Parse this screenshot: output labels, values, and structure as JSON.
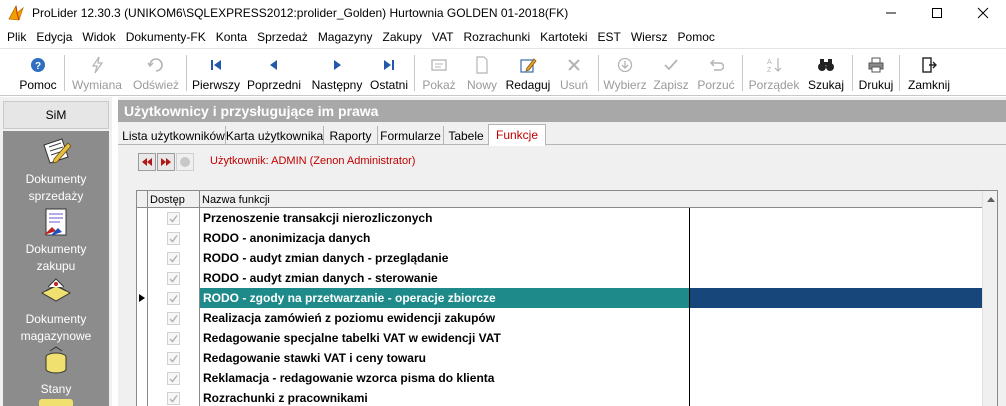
{
  "window": {
    "title": "ProLider 12.30.3  (UNIKOM6\\SQLEXPRESS2012:prolider_Golden) Hurtownia GOLDEN 01-2018(FK)"
  },
  "menu": [
    "Plik",
    "Edycja",
    "Widok",
    "Dokumenty-FK",
    "Konta",
    "Sprzedaż",
    "Magazyny",
    "Zakupy",
    "VAT",
    "Rozrachunki",
    "Kartoteki",
    "EST",
    "Wiersz",
    "Pomoc"
  ],
  "toolbar": {
    "pomoc": "Pomoc",
    "wymiana": "Wymiana",
    "odswiez": "Odśwież",
    "pierwszy": "Pierwszy",
    "poprzedni": "Poprzedni",
    "nastepny": "Następny",
    "ostatni": "Ostatni",
    "pokaz": "Pokaż",
    "nowy": "Nowy",
    "redaguj": "Redaguj",
    "usun": "Usuń",
    "wybierz": "Wybierz",
    "zapisz": "Zapisz",
    "porzuc": "Porzuć",
    "porzadek": "Porządek",
    "szukaj": "Szukaj",
    "drukuj": "Drukuj",
    "zamknij": "Zamknij"
  },
  "sidebar": {
    "header": "SiM",
    "items": [
      {
        "label": "Dokumenty sprzedaży",
        "icon": "sales-documents-icon"
      },
      {
        "label": "Dokumenty zakupu",
        "icon": "purchase-documents-icon"
      },
      {
        "label": "Dokumenty magazynowe",
        "icon": "warehouse-documents-icon"
      },
      {
        "label": "Stany",
        "icon": "stock-levels-icon"
      }
    ]
  },
  "main": {
    "title": "Użytkownicy i przysługujące im prawa",
    "tabs": [
      "Lista użytkowników",
      "Karta użytkownika",
      "Raporty",
      "Formularze",
      "Tabele",
      "Funkcje"
    ],
    "active_tab": "Funkcje",
    "user_label": "Użytkownik: ADMIN  (Zenon Administrator)"
  },
  "grid": {
    "columns": [
      "Dostęp",
      "Nazwa funkcji"
    ],
    "rows": [
      {
        "checked": true,
        "name": "Przenoszenie transakcji nierozliczonych"
      },
      {
        "checked": true,
        "name": "RODO - anonimizacja danych"
      },
      {
        "checked": true,
        "name": "RODO - audyt zmian danych - przeglądanie"
      },
      {
        "checked": true,
        "name": "RODO - audyt zmian danych - sterowanie"
      },
      {
        "checked": true,
        "name": "RODO - zgody na przetwarzanie - operacje zbiorcze",
        "selected": true
      },
      {
        "checked": true,
        "name": "Realizacja zamówień z poziomu ewidencji zakupów"
      },
      {
        "checked": true,
        "name": "Redagowanie specjalne tabelki VAT w ewidencji VAT"
      },
      {
        "checked": true,
        "name": "Redagowanie stawki VAT i ceny towaru"
      },
      {
        "checked": true,
        "name": "Reklamacja - redagowanie wzorca pisma do klienta"
      },
      {
        "checked": true,
        "name": "Rozrachunki z pracownikami"
      }
    ]
  },
  "colors": {
    "selected_cell": "#1f8a8a",
    "selected_row": "#16467a",
    "accent_red": "#c00000",
    "sidebar_bg": "#8c8c8c",
    "title_bar_bg": "#a8a8a8"
  }
}
